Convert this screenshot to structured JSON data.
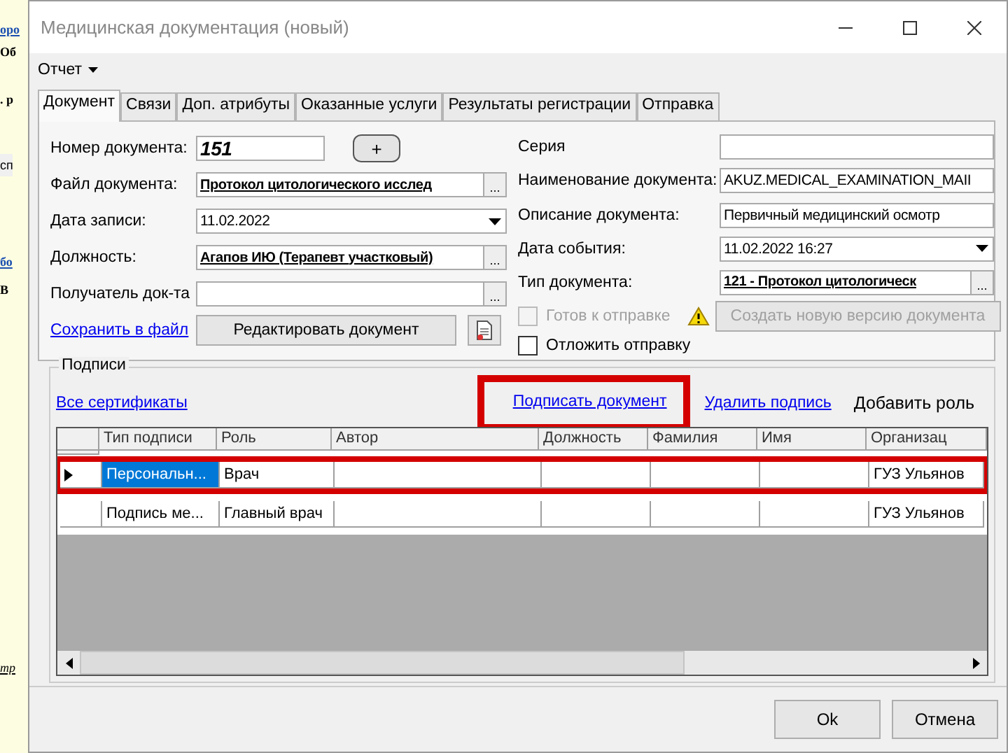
{
  "background_fragments": [
    {
      "text": "оро",
      "kind": "link"
    },
    {
      "text": "Об",
      "kind": "bold"
    },
    {
      "text": ". р",
      "kind": "bold"
    },
    {
      "text": "сп",
      "kind": "band"
    },
    {
      "text": "бо",
      "kind": "link"
    },
    {
      "text": "В",
      "kind": "bold"
    },
    {
      "text": "тр",
      "kind": "italic"
    }
  ],
  "window": {
    "title": "Медицинская документация (новый)"
  },
  "menu": [
    {
      "label": "Отчет"
    }
  ],
  "tabs": [
    {
      "label": "Документ",
      "selected": true
    },
    {
      "label": "Связи",
      "selected": false
    },
    {
      "label": "Доп. атрибуты",
      "selected": false
    },
    {
      "label": "Оказанные услуги",
      "selected": false
    },
    {
      "label": "Результаты регистрации",
      "selected": false
    },
    {
      "label": "Отправка",
      "selected": false
    }
  ],
  "left_fields": [
    {
      "label": "Номер документа:",
      "value": "151",
      "kind": "number",
      "add_button": "+"
    },
    {
      "label": "Файл документа:",
      "value": "Протокол цитологического исслед",
      "kind": "picker",
      "button": "..."
    },
    {
      "label": "Дата записи:",
      "value": "11.02.2022",
      "kind": "dropdown"
    },
    {
      "label": "Должность:",
      "value": "Агапов ИЮ (Терапевт участковый)",
      "kind": "picker",
      "button": "..."
    },
    {
      "label": "Получатель док-та",
      "kind": "picker",
      "button": "..."
    }
  ],
  "right_fields": [
    {
      "label": "Серия",
      "kind": "text"
    },
    {
      "label": "Наименование документа:",
      "value": "AKUZ.MEDICAL_EXAMINATION_MAII",
      "kind": "text"
    },
    {
      "label": "Описание документа:",
      "value": "Первичный медицинский осмотр",
      "kind": "text"
    },
    {
      "label": "Дата события:",
      "value": "11.02.2022 16:27",
      "kind": "dropdown"
    },
    {
      "label": "Тип документа:",
      "value": "121 - Протокол цитологическ",
      "kind": "picker",
      "button": "..."
    }
  ],
  "save_link": "Сохранить в файл",
  "edit_button": "Редактировать документ",
  "checkboxes": [
    {
      "label": "Готов к отправке",
      "checked": false,
      "disabled": true
    },
    {
      "label": "Отложить отправку",
      "checked": false,
      "disabled": false
    }
  ],
  "new_version_button": {
    "label": "Создать новую версию документа",
    "disabled": true
  },
  "signatures": {
    "title": "Подписи",
    "all_certificates": "Все сертификаты",
    "actions": [
      {
        "label": "Подписать документ",
        "kind": "link",
        "highlighted": true
      },
      {
        "label": "Удалить подпись",
        "kind": "link",
        "highlighted": false
      },
      {
        "label": "Добавить роль",
        "kind": "button",
        "highlighted": false
      }
    ],
    "columns": [
      "Тип подписи",
      "Роль",
      "Автор",
      "Должность",
      "Фамилия",
      "Имя",
      "Организац"
    ],
    "rows": [
      {
        "type": "Персональн...",
        "role": "Врач",
        "organization": "ГУЗ Ульянов",
        "selected": true,
        "highlighted": true
      },
      {
        "type": "Подпись ме...",
        "role": "Главный врач",
        "organization": "ГУЗ Ульянов",
        "selected": false,
        "highlighted": false
      }
    ]
  },
  "buttons": [
    "Ok",
    "Отмена"
  ]
}
